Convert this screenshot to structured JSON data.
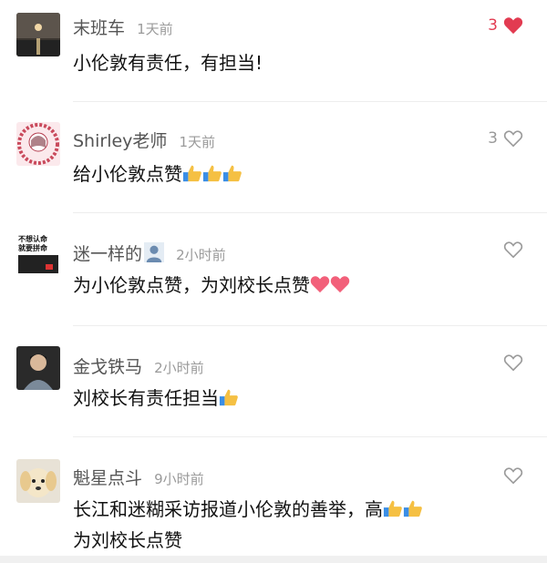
{
  "comments": [
    {
      "username": "末班车",
      "time": "1天前",
      "likes": "3",
      "liked": true,
      "text": "小伦敦有责任，有担当!",
      "avatar": "sunset-avatar"
    },
    {
      "username": "Shirley老师",
      "time": "1天前",
      "likes": "3",
      "liked": false,
      "text": "给小伦敦点赞",
      "avatar": "floral-portrait-avatar"
    },
    {
      "username": "迷一样的",
      "time": "2小时前",
      "likes": "",
      "liked": false,
      "text": "为小伦敦点赞，为刘校长点赞",
      "avatar": "text-poster-avatar",
      "avatar_text_1": "不想认命",
      "avatar_text_2": "就要拼命"
    },
    {
      "username": "金戈铁马",
      "time": "2小时前",
      "likes": "",
      "liked": false,
      "text": "刘校长有责任担当",
      "avatar": "person-avatar"
    },
    {
      "username": "魁星点斗",
      "time": "9小时前",
      "likes": "",
      "liked": false,
      "text": "长江和迷糊采访报道小伦敦的善举，高",
      "text_line2": "为刘校长点赞",
      "avatar": "puppy-avatar"
    }
  ],
  "colors": {
    "liked": "#e23b51",
    "icon": "#9a9a9a",
    "thumb": "#f5c043",
    "sleeve": "#3a8ee6"
  }
}
